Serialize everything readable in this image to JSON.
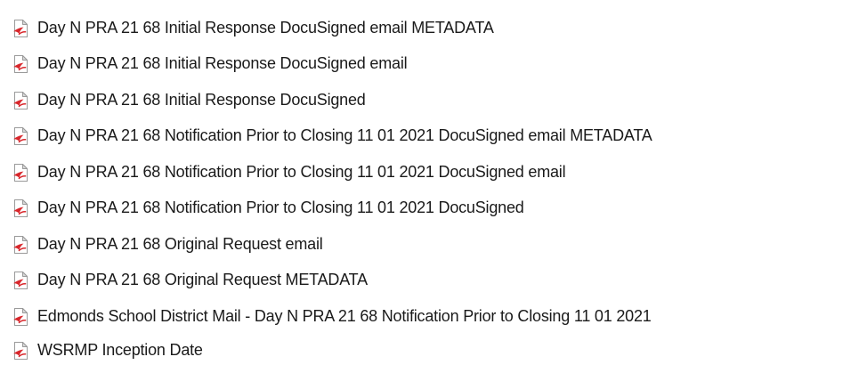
{
  "files": [
    {
      "name": "Day N PRA 21 68 Initial Response DocuSigned email METADATA",
      "icon": "pdf-file-icon"
    },
    {
      "name": "Day N PRA 21 68 Initial Response DocuSigned email",
      "icon": "pdf-file-icon"
    },
    {
      "name": "Day N PRA 21 68 Initial Response DocuSigned",
      "icon": "pdf-file-icon"
    },
    {
      "name": "Day N PRA 21 68 Notification Prior to Closing 11 01 2021 DocuSigned email METADATA",
      "icon": "pdf-file-icon"
    },
    {
      "name": "Day N PRA 21 68 Notification Prior to Closing 11 01 2021 DocuSigned email",
      "icon": "pdf-file-icon"
    },
    {
      "name": "Day N PRA 21 68 Notification Prior to Closing 11 01 2021 DocuSigned",
      "icon": "pdf-file-icon"
    },
    {
      "name": "Day N PRA 21 68 Original Request email",
      "icon": "pdf-file-icon"
    },
    {
      "name": "Day N PRA 21 68 Original Request METADATA",
      "icon": "pdf-file-icon"
    },
    {
      "name": "Edmonds School District Mail - Day N PRA 21 68 Notification Prior to Closing 11 01 2021",
      "icon": "pdf-file-icon"
    },
    {
      "name": "WSRMP Inception Date",
      "icon": "pdf-file-icon"
    }
  ],
  "colors": {
    "icon_paper": "#ffffff",
    "icon_fold": "#d9d9d9",
    "icon_outline": "#9a9a9a",
    "icon_red": "#d8262b",
    "text": "#1a1a1a"
  }
}
